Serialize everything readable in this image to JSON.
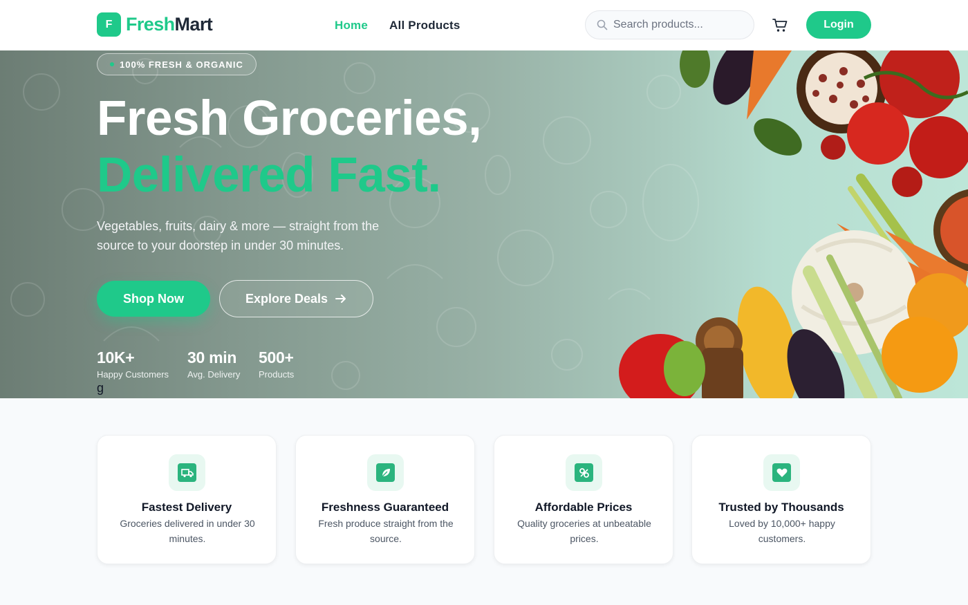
{
  "brand": {
    "mark": "F",
    "name_part1": "Fresh",
    "name_part2": "Mart"
  },
  "nav": {
    "home": "Home",
    "all_products": "All Products"
  },
  "search": {
    "placeholder": "Search products...",
    "value": ""
  },
  "cart": {
    "icon": "cart-icon"
  },
  "login_label": "Login",
  "hero": {
    "badge": "100% FRESH & ORGANIC",
    "title_line1": "Fresh Groceries,",
    "title_line2": "Delivered Fast.",
    "subtitle": "Vegetables, fruits, dairy & more — straight from the source to your doorstep in under 30 minutes.",
    "shop_now": "Shop Now",
    "explore_deals": "Explore Deals",
    "stats": [
      {
        "value": "10K+",
        "label": "Happy Customers"
      },
      {
        "value": "30 min",
        "label": "Avg. Delivery"
      },
      {
        "value": "500+",
        "label": "Products"
      }
    ],
    "stray_text": "g"
  },
  "features": [
    {
      "icon": "truck-icon",
      "title": "Fastest Delivery",
      "desc": "Groceries delivered in under 30 minutes."
    },
    {
      "icon": "leaf-icon",
      "title": "Freshness Guaranteed",
      "desc": "Fresh produce straight from the source."
    },
    {
      "icon": "percent-icon",
      "title": "Affordable Prices",
      "desc": "Quality groceries at unbeatable prices."
    },
    {
      "icon": "heart-icon",
      "title": "Trusted by Thousands",
      "desc": "Loved by 10,000+ happy customers."
    }
  ],
  "colors": {
    "accent": "#1fc98a",
    "text_dark": "#1f2937",
    "page_bg": "#f8fafc"
  }
}
